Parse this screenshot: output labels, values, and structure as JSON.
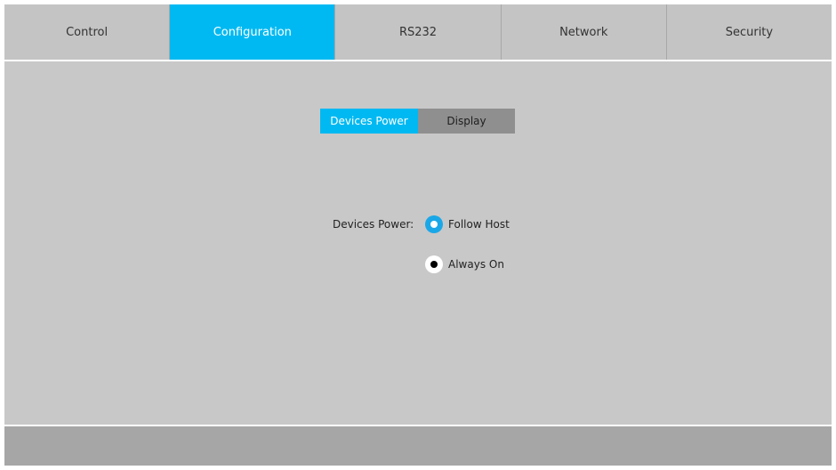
{
  "nav": {
    "tabs": [
      {
        "label": "Control",
        "active": false
      },
      {
        "label": "Configuration",
        "active": true
      },
      {
        "label": "RS232",
        "active": false
      },
      {
        "label": "Network",
        "active": false
      },
      {
        "label": "Security",
        "active": false
      }
    ]
  },
  "subtabs": {
    "devices_power": "Devices Power",
    "display": "Display",
    "active": "devices_power"
  },
  "form": {
    "devices_power_label": "Devices Power:",
    "options": [
      {
        "label": "Follow Host",
        "checked": true
      },
      {
        "label": "Always On",
        "checked": false
      }
    ]
  },
  "colors": {
    "accent": "#00b9f2",
    "background": "#c8c8c8",
    "footer": "#a6a6a6",
    "inactive_subtab": "#8f8f8f"
  }
}
